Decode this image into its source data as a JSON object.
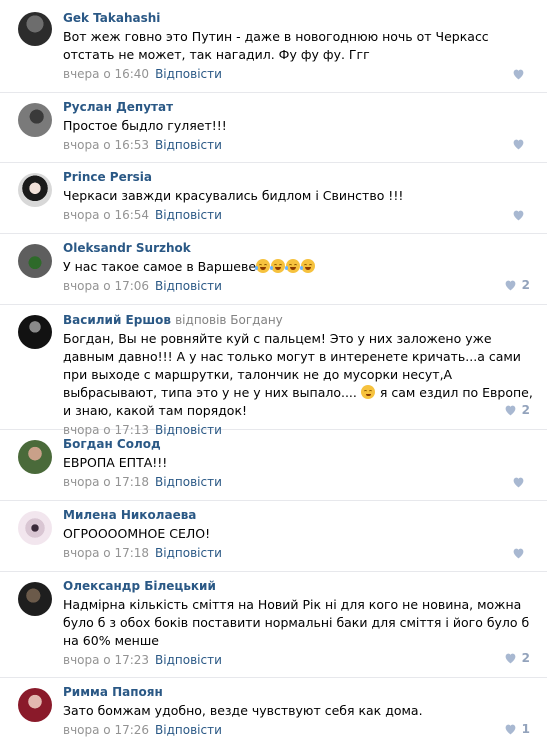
{
  "comments": [
    {
      "author": "Gek Takahashi",
      "text": "Вот жеж говно это Путин - даже в новогоднюю ночь от Черкасс отстать не может, так нагадил. Фу фу фу. Ггг",
      "time": "вчера о 16:40",
      "reply": "Відповісти",
      "likes": ""
    },
    {
      "author": "Руслан Депутат",
      "text": "Простое быдло гуляет!!!",
      "time": "вчора о 16:53",
      "reply": "Відповісти",
      "likes": ""
    },
    {
      "author": "Prince Persia",
      "text": "Черкаси завжди красувались бидлом і Свинство !!!",
      "time": "вчора о 16:54",
      "reply": "Відповісти",
      "likes": ""
    },
    {
      "author": "Oleksandr Surzhok",
      "text": "У нас такое самое в Варшеве",
      "time": "вчора о 17:06",
      "reply": "Відповісти",
      "likes": "2"
    },
    {
      "author": "Василий Ершов",
      "reply_to": "відповів Богдану",
      "text_before": "Богдан, Вы не ровняйте куй с пальцем! Это у них заложено уже давным давно!!! А у нас только могут в интеренете кричать...а сами при выходе с маршрутки, талончик не до мусорки несут,А выбрасывают, типа это у не у них выпало....",
      "text_after": " я сам ездил по Европе, и знаю, какой там порядок!",
      "time": "вчора о 17:13",
      "reply": "Відповісти",
      "likes": "2"
    },
    {
      "author": "Богдан Солод",
      "text": "ЕВРОПА ЕПТА!!!",
      "time": "вчора о 17:18",
      "reply": "Відповісти",
      "likes": ""
    },
    {
      "author": "Милена Николаева",
      "text": "ОГРОООOМНОЕ СЕЛО!",
      "time": "вчора о 17:18",
      "reply": "Відповісти",
      "likes": ""
    },
    {
      "author": "Олександр Білецький",
      "text": "Надмірна кількість сміття на Новий Рік ні для кого не новина, можна було б з обох боків поставити нормальні баки для сміття і його було б на 60% менше",
      "time": "вчора о 17:23",
      "reply": "Відповісти",
      "likes": "2"
    },
    {
      "author": "Римма Папоян",
      "text": "Зато бомжам удобно, везде чувствуют себя как дома.",
      "time": "вчора о 17:26",
      "reply": "Відповісти",
      "likes": "1"
    }
  ],
  "icons": {
    "like": "heart-icon",
    "emoji_laugh": "tears-of-joy-emoji-icon",
    "emoji_wink": "winking-emoji-icon"
  },
  "colors": {
    "link": "#2a5885",
    "meta": "#939393",
    "like": "#93a3bc",
    "divider": "#e7e8ec"
  }
}
